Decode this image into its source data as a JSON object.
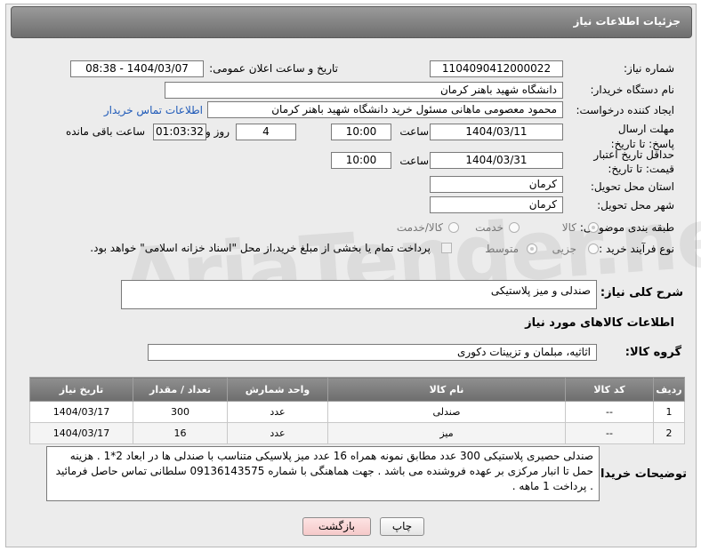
{
  "header": {
    "title": "جزئیات اطلاعات نیاز"
  },
  "fields": {
    "need_number_label": "شماره نیاز:",
    "need_number": "1104090412000022",
    "announce_label": "تاریخ و ساعت اعلان عمومی:",
    "announce_value": "1404/03/07 - 08:38",
    "buyer_org_label": "نام دستگاه خریدار:",
    "buyer_org": "دانشگاه شهید باهنر کرمان",
    "requester_label": "ایجاد کننده درخواست:",
    "requester": "محمود معصومی ماهانی مسئول خرید  دانشگاه شهید باهنر کرمان",
    "buyer_contact_link": "اطلاعات تماس خریدار",
    "reply_deadline_label": "مهلت ارسال پاسخ: تا تاریخ:",
    "reply_date": "1404/03/11",
    "time_label": "ساعت",
    "reply_time": "10:00",
    "days_value": "4",
    "days_label": "روز و",
    "remaining_value": "01:03:32",
    "remaining_label": "ساعت باقی مانده",
    "price_validity_label": "حداقل تاریخ اعتبار قیمت: تا تاریخ:",
    "price_date": "1404/03/31",
    "price_time": "10:00",
    "province_label": "استان محل تحویل:",
    "province": "کرمان",
    "city_label": "شهر محل تحویل:",
    "city": "کرمان",
    "category_label": "طبقه بندی موضوعی:",
    "category_options": [
      "کالا",
      "خدمت",
      "کالا/خدمت"
    ],
    "process_label": "نوع فرآیند خرید :",
    "process_options": [
      "جزیی",
      "متوسط"
    ],
    "payment_note": "پرداخت تمام یا بخشی از مبلغ خرید،از محل \"اسناد خزانه اسلامی\" خواهد بود."
  },
  "summary": {
    "label": "شرح کلی نیاز:",
    "value": "صندلی و میز پلاستیکی",
    "goods_info_title": "اطلاعات کالاهای مورد نیاز",
    "group_label": "گروه کالا:",
    "group_value": "اثاثیه، مبلمان و تزیینات دکوری"
  },
  "table": {
    "headers": [
      "ردیف",
      "کد کالا",
      "نام کالا",
      "واحد شمارش",
      "تعداد / مقدار",
      "تاریخ نیاز"
    ],
    "rows": [
      [
        "1",
        "--",
        "صندلی",
        "عدد",
        "300",
        "1404/03/17"
      ],
      [
        "2",
        "--",
        "میز",
        "عدد",
        "16",
        "1404/03/17"
      ]
    ]
  },
  "notes": {
    "label": "توضیحات خریدار:",
    "text": "صندلی حصیری پلاستیکی 300 عدد مطابق نمونه همراه 16 عدد  میز پلاسیکی متناسب با صندلی ها در ابعاد 2*1 . هزینه حمل تا انبار مرکزی بر عهده فروشنده می باشد . جهت هماهنگی با شماره 09136143575 سلطانی تماس حاصل فرمائید . پرداخت 1 ماهه ."
  },
  "buttons": {
    "print": "چاپ",
    "back": "بازگشت"
  },
  "watermark": "AriaTender.neT"
}
